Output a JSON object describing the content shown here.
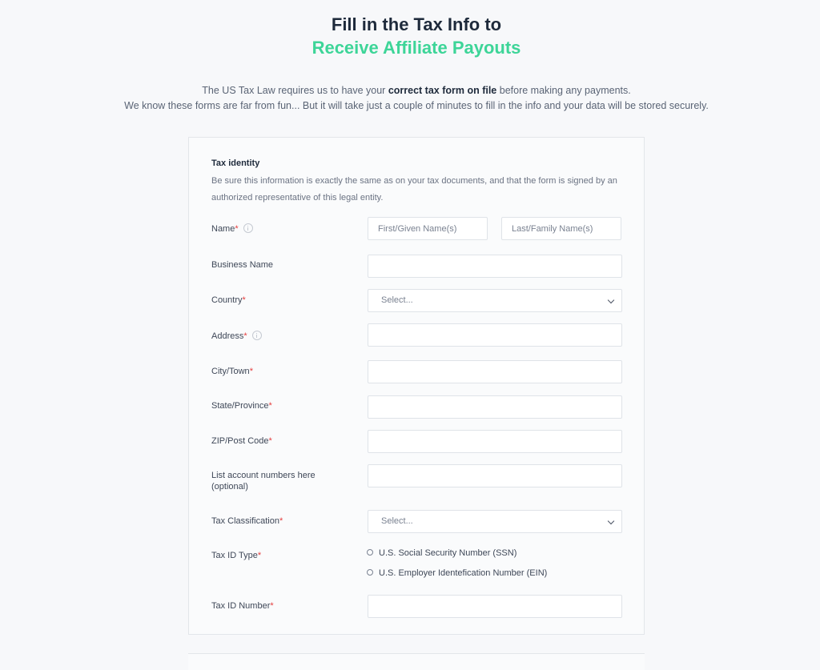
{
  "header": {
    "title_line1": "Fill in the Tax Info to",
    "title_line2": "Receive Affiliate Payouts",
    "accent_color": "#3dd598"
  },
  "intro": {
    "line1_before": "The US Tax Law requires us to have your ",
    "line1_bold": "correct tax form on file",
    "line1_after": " before making any payments.",
    "line2": "We know these forms are far from fun... But it will take just a couple of minutes to fill in the info and your data will be stored securely."
  },
  "form": {
    "section_title": "Tax identity",
    "section_description": "Be sure this information is exactly the same as on your tax documents, and that the form is signed by an authorized representative of this legal entity.",
    "required_marker": "*",
    "fields": {
      "name": {
        "label": "Name",
        "first_placeholder": "First/Given Name(s)",
        "last_placeholder": "Last/Family Name(s)",
        "first_value": "",
        "last_value": ""
      },
      "business_name": {
        "label": "Business Name",
        "value": ""
      },
      "country": {
        "label": "Country",
        "selected": "Select..."
      },
      "address": {
        "label": "Address",
        "value": ""
      },
      "city": {
        "label": "City/Town",
        "value": ""
      },
      "state": {
        "label": "State/Province",
        "value": ""
      },
      "zip": {
        "label": "ZIP/Post Code",
        "value": ""
      },
      "account_numbers": {
        "label_line1": "List account numbers here",
        "label_line2": "(optional)",
        "value": ""
      },
      "tax_classification": {
        "label": "Tax Classification",
        "selected": "Select..."
      },
      "tax_id_type": {
        "label": "Tax ID Type",
        "options": [
          {
            "label": "U.S. Social Security Number (SSN)",
            "checked": false
          },
          {
            "label": "U.S. Employer Identefication Number (EIN)",
            "checked": false
          }
        ]
      },
      "tax_id_number": {
        "label": "Tax ID Number",
        "value": ""
      }
    }
  }
}
